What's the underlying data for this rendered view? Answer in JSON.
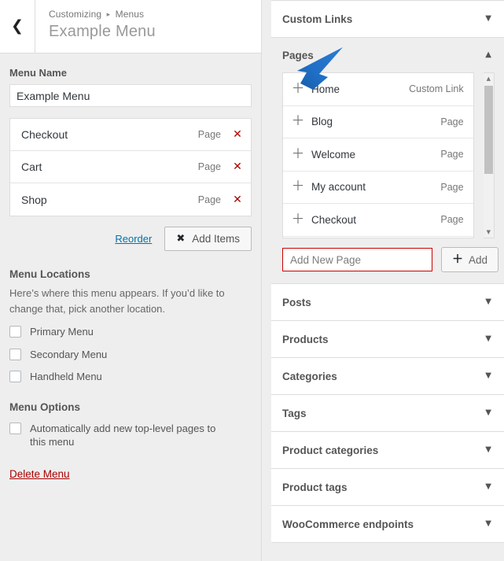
{
  "header": {
    "back_icon": "chevron-left-icon",
    "breadcrumb_root": "Customizing",
    "breadcrumb_separator": "▸",
    "breadcrumb_current": "Menus",
    "title": "Example Menu"
  },
  "menu_name": {
    "label": "Menu Name",
    "value": "Example Menu"
  },
  "menu_items": [
    {
      "title": "Checkout",
      "type": "Page",
      "delete_icon": "✕"
    },
    {
      "title": "Cart",
      "type": "Page",
      "delete_icon": "✕"
    },
    {
      "title": "Shop",
      "type": "Page",
      "delete_icon": "✕"
    }
  ],
  "list_actions": {
    "reorder_label": "Reorder",
    "add_items_label": "Add Items",
    "add_items_icon": "✖"
  },
  "menu_locations": {
    "title": "Menu Locations",
    "description": "Here’s where this menu appears. If you’d like to change that, pick another location.",
    "options": [
      {
        "label": "Primary Menu",
        "checked": false
      },
      {
        "label": "Secondary Menu",
        "checked": false
      },
      {
        "label": "Handheld Menu",
        "checked": false
      }
    ]
  },
  "menu_options": {
    "title": "Menu Options",
    "auto_add_label": "Automatically add new top-level pages to this menu",
    "auto_add_checked": false,
    "delete_menu_label": "Delete Menu"
  },
  "add_items_panel": {
    "custom_links": {
      "label": "Custom Links",
      "caret": "▼",
      "expanded": false
    },
    "pages": {
      "label": "Pages",
      "caret": "▲",
      "expanded": true,
      "items": [
        {
          "name": "Home",
          "type": "Custom Link",
          "add_icon": "＋"
        },
        {
          "name": "Blog",
          "type": "Page",
          "add_icon": "＋"
        },
        {
          "name": "Welcome",
          "type": "Page",
          "add_icon": "＋"
        },
        {
          "name": "My account",
          "type": "Page",
          "add_icon": "＋"
        },
        {
          "name": "Checkout",
          "type": "Page",
          "add_icon": "＋"
        }
      ],
      "scrollbar": {
        "up_arrow": "▲",
        "down_arrow": "▼"
      },
      "add_new_placeholder": "Add New Page",
      "add_new_value": "",
      "add_button_label": "Add",
      "add_button_icon": "＋"
    },
    "sections": [
      {
        "label": "Posts",
        "caret": "▼"
      },
      {
        "label": "Products",
        "caret": "▼"
      },
      {
        "label": "Categories",
        "caret": "▼"
      },
      {
        "label": "Tags",
        "caret": "▼"
      },
      {
        "label": "Product categories",
        "caret": "▼"
      },
      {
        "label": "Product tags",
        "caret": "▼"
      },
      {
        "label": "WooCommerce endpoints",
        "caret": "▼"
      }
    ]
  },
  "annotation": {
    "type": "arrow",
    "color": "#1f6fc6",
    "points_at": "Home"
  },
  "colors": {
    "background": "#eeeeee",
    "panel": "#ffffff",
    "link": "#0073aa",
    "danger": "#aa0000",
    "input_error_border": "#cc0000",
    "annotation_blue": "#1f6fc6"
  }
}
